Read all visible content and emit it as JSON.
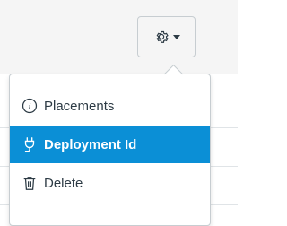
{
  "toolbar": {
    "settings_icon": "gear-icon",
    "dropdown_icon": "caret-down-icon"
  },
  "menu": {
    "items": [
      {
        "label": "Placements",
        "icon": "info-icon",
        "selected": false
      },
      {
        "label": "Deployment Id",
        "icon": "plug-icon",
        "selected": true
      },
      {
        "label": "Delete",
        "icon": "trash-icon",
        "selected": false
      }
    ]
  },
  "colors": {
    "accent": "#0b8fd6",
    "text": "#2d3b45",
    "border": "#c7cdd1",
    "background": "#f5f5f5"
  }
}
